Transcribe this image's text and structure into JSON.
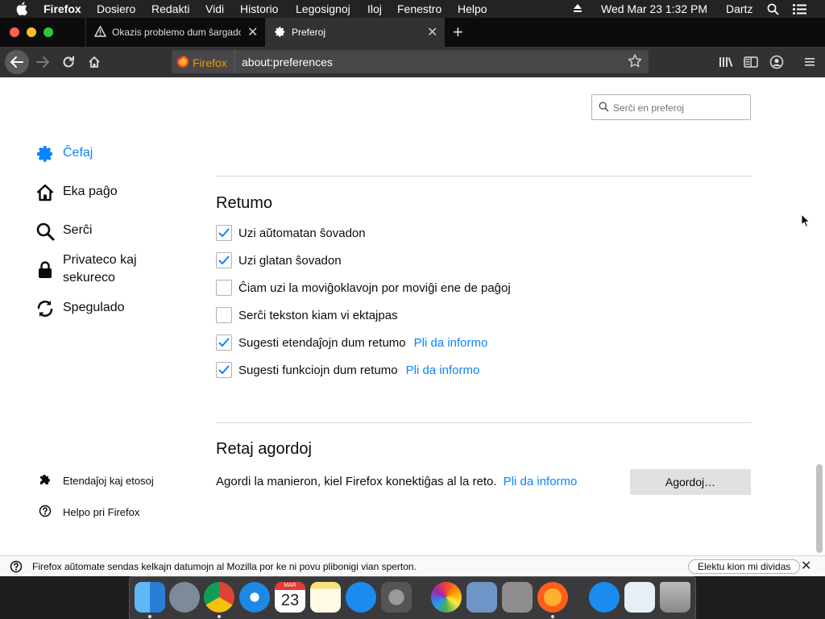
{
  "menubar": {
    "app": "Firefox",
    "items": [
      "Dosiero",
      "Redakti",
      "Vidi",
      "Historio",
      "Legosignoj",
      "Iloj",
      "Fenestro",
      "Helpo"
    ],
    "clock": "Wed Mar 23  1:32 PM",
    "user": "Dartz"
  },
  "tabs": [
    {
      "label": "Okazis problemo dum ŝargado",
      "icon": "warning-icon"
    },
    {
      "label": "Preferoj",
      "icon": "gear-icon",
      "active": true
    }
  ],
  "urlbar": {
    "identity": "Firefox",
    "url": "about:preferences"
  },
  "search": {
    "placeholder": "Serĉi en preferoj"
  },
  "sidebar": {
    "categories": [
      {
        "label": "Ĉefaj",
        "icon": "gear-icon",
        "selected": true
      },
      {
        "label": "Eka paĝo",
        "icon": "home-icon"
      },
      {
        "label": "Serĉi",
        "icon": "search-icon"
      },
      {
        "label": "Privateco kaj sekureco",
        "icon": "lock-icon"
      },
      {
        "label": "Spegulado",
        "icon": "sync-icon"
      }
    ],
    "footer": [
      {
        "label": "Etendaĵoj kaj etosoj",
        "icon": "puzzle-icon"
      },
      {
        "label": "Helpo pri Firefox",
        "icon": "help-icon"
      }
    ]
  },
  "browsing": {
    "heading": "Retumo",
    "learn_more": "Pli da informo",
    "options": [
      {
        "label": "Uzi aŭtomatan ŝovadon",
        "checked": true
      },
      {
        "label": "Uzi glatan ŝovadon",
        "checked": true
      },
      {
        "label": "Ĉiam uzi la moviĝoklavojn por moviĝi ene de paĝoj",
        "checked": false
      },
      {
        "label": "Serĉi tekston kiam vi ektajpas",
        "checked": false
      },
      {
        "label": "Sugesti etendaĵojn dum retumo",
        "checked": true
      },
      {
        "label": "Sugesti funkciojn dum retumo",
        "checked": true
      }
    ]
  },
  "network": {
    "heading": "Retaj agordoj",
    "description": "Agordi la manieron, kiel Firefox konektiĝas al la reto.",
    "learn_more": "Pli da informo",
    "button": "Agordoj…"
  },
  "notification": {
    "message": "Firefox aŭtomate sendas kelkajn datumojn al Mozilla por ke ni povu plibonigi vian sperton.",
    "button": "Elektu kion mi dividas"
  },
  "dock": {
    "apps": [
      "Finder",
      "Launchpad",
      "Chrome",
      "Safari",
      "Calendar",
      "Notes",
      "App Store",
      "System Preferences",
      "Photos",
      "Preview",
      "Utility",
      "Firefox",
      "App Store",
      "Downloads",
      "Trash"
    ],
    "calendar_month": "MAR",
    "calendar_day": "23"
  },
  "colors": {
    "accent": "#0a84ff",
    "chrome_dark": "#0c0c0d",
    "toolbar": "#323234"
  }
}
